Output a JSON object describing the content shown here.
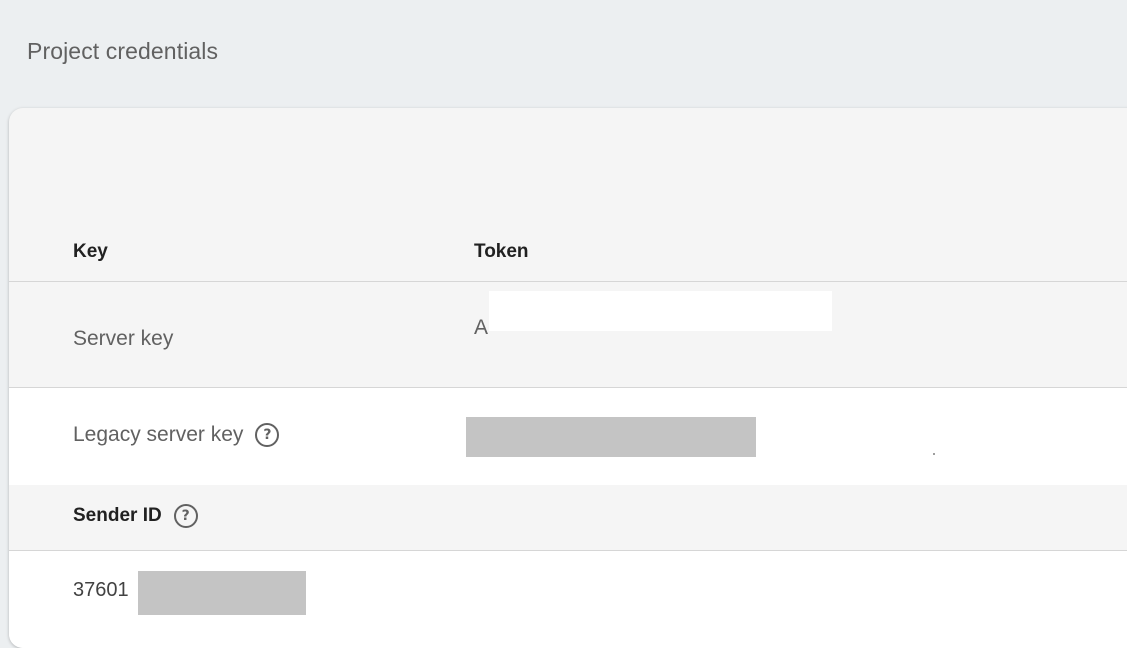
{
  "section": {
    "title": "Project credentials"
  },
  "table": {
    "headers": {
      "key": "Key",
      "token": "Token"
    },
    "rows": [
      {
        "key": "Server key",
        "token_prefix": "A"
      },
      {
        "key": "Legacy server key",
        "help_icon": "help-circle-icon"
      }
    ],
    "sender": {
      "label": "Sender ID",
      "help_icon": "help-circle-icon",
      "value_prefix": "37601"
    }
  },
  "colors": {
    "page_bg": "#eceff1",
    "card_bg": "#f5f5f5",
    "redaction_grey": "#c4c4c4"
  }
}
